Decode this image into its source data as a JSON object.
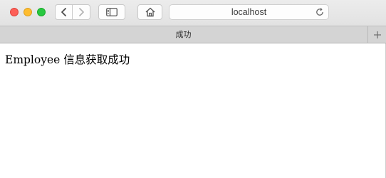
{
  "browser": {
    "toolbar": {
      "traffic_lights": {
        "close": "#fd5f57",
        "minimize": "#febc2e",
        "maximize": "#28c840"
      },
      "back_icon": "chevron-left-icon",
      "forward_icon": "chevron-right-icon",
      "sidebar_icon": "sidebar-icon",
      "home_icon": "home-icon",
      "reload_icon": "reload-icon"
    },
    "address_bar": {
      "url": "localhost"
    },
    "tab": {
      "title": "成功"
    },
    "new_tab_icon": "plus-icon"
  },
  "page": {
    "message": "Employee 信息获取成功"
  }
}
